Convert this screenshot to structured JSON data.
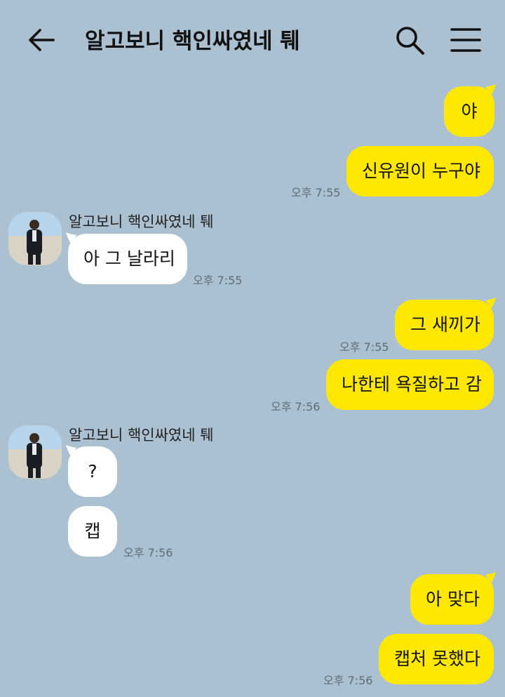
{
  "header": {
    "title": "알고보니 핵인싸였네 퉤",
    "back_icon": "arrow-left-icon",
    "search_icon": "search-icon",
    "menu_icon": "hamburger-menu-icon"
  },
  "colors": {
    "background": "#abc1d1",
    "my_bubble": "#fee800",
    "their_bubble": "#ffffff"
  },
  "messages": [
    {
      "from": "me",
      "text": "야"
    },
    {
      "from": "me",
      "text": "신유원이 누구야",
      "time": "오후 7:55"
    },
    {
      "from": "them",
      "sender": "알고보니 핵인싸였네 퉤",
      "text": "아 그 날라리",
      "time": "오후 7:55"
    },
    {
      "from": "me",
      "text": "그 새끼가",
      "time": "오후 7:55"
    },
    {
      "from": "me",
      "text": "나한테 욕질하고 감",
      "time": "오후 7:56"
    },
    {
      "from": "them",
      "sender": "알고보니 핵인싸였네 퉤",
      "text": "?"
    },
    {
      "from": "them",
      "text": "캡",
      "time": "오후 7:56"
    },
    {
      "from": "me",
      "text": "아 맞다"
    },
    {
      "from": "me",
      "text": "캡처 못했다",
      "time": "오후 7:56"
    }
  ]
}
